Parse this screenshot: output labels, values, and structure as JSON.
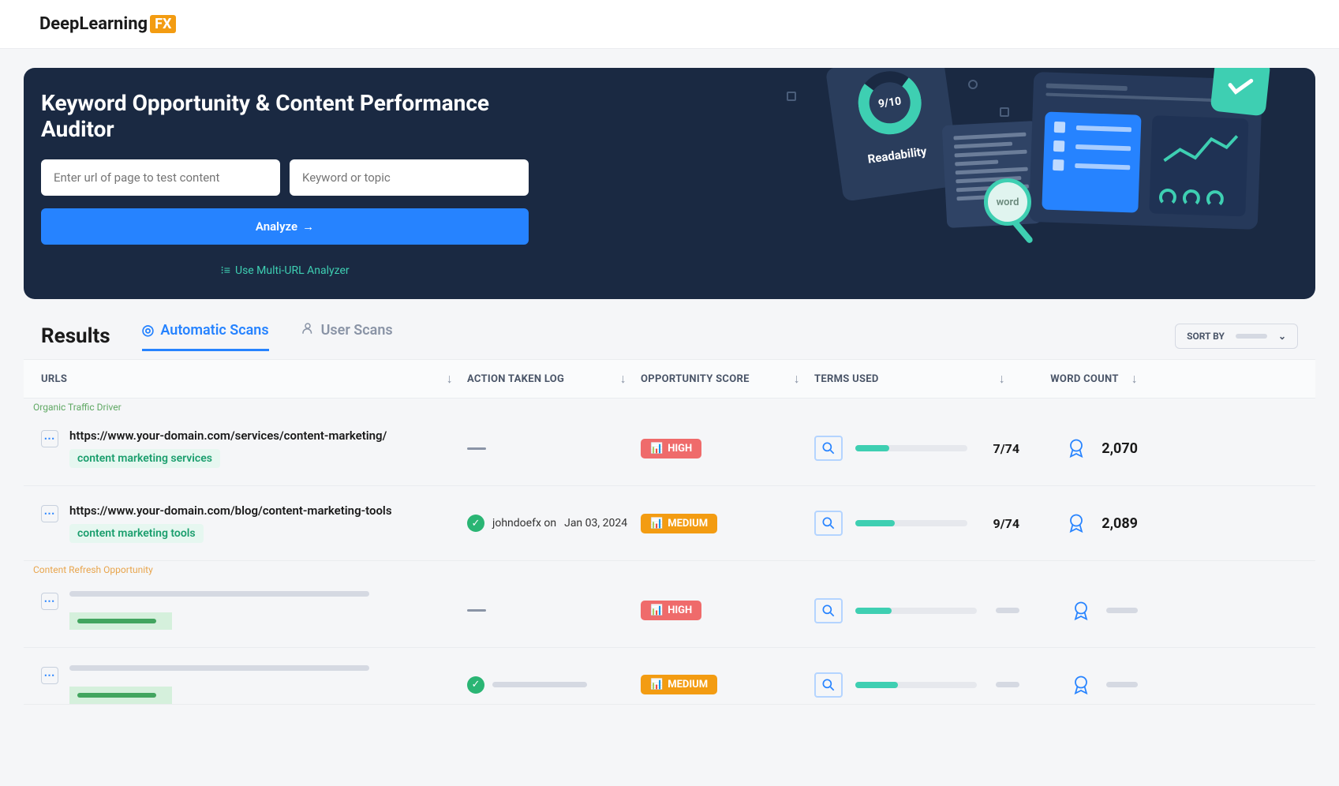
{
  "logo": {
    "main": "DeepLearning",
    "fx": "FX"
  },
  "hero": {
    "title": "Keyword Opportunity & Content Performance Auditor",
    "url_placeholder": "Enter url of page to test content",
    "keyword_placeholder": "Keyword or topic",
    "analyze": "Analyze",
    "multi_url": "Use Multi-URL Analyzer"
  },
  "graphics": {
    "readability_score": "9/10",
    "readability_label": "Readability",
    "word_label": "word"
  },
  "results": {
    "title": "Results",
    "tabs": {
      "automatic": "Automatic Scans",
      "user": "User Scans"
    },
    "sort_by": "SORT BY",
    "columns": {
      "urls": "URLS",
      "action": "ACTION TAKEN LOG",
      "score": "OPPORTUNITY SCORE",
      "terms": "TERMS USED",
      "wc": "WORD COUNT"
    }
  },
  "tags": {
    "organic": "Organic Traffic Driver",
    "refresh": "Content Refresh Opportunity"
  },
  "rows": [
    {
      "url": "https://www.your-domain.com/services/content-marketing/",
      "keyword": "content marketing services",
      "action_user": "",
      "action_date": "",
      "score": "HIGH",
      "terms": "7/74",
      "terms_pct": 30,
      "wc": "2,070"
    },
    {
      "url": "https://www.your-domain.com/blog/content-marketing-tools",
      "keyword": "content marketing tools",
      "action_user": "johndoefx on",
      "action_date": "Jan 03, 2024",
      "score": "MEDIUM",
      "terms": "9/74",
      "terms_pct": 35,
      "wc": "2,089"
    }
  ],
  "skeleton_scores": {
    "r2_score": "HIGH",
    "r3_score": "MEDIUM"
  }
}
